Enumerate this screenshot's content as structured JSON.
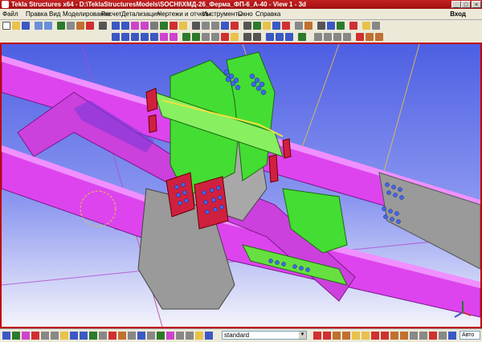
{
  "window": {
    "title": "Tekla Structures x64 - D:\\TeklaStructuresModels\\SOCHI\\ХМД-26_Ферма_ФП-6_А-40 - View 1 - 3d"
  },
  "menu": {
    "items": [
      "Файл",
      "Правка",
      "Вид",
      "Моделирование",
      "Расчет",
      "Детализация",
      "Чертежи и отчеты",
      "Инструменты",
      "Окно",
      "Справка"
    ],
    "login": "Вход"
  },
  "statusbar": {
    "selection_filter": "standard",
    "snap_mode": "Авто"
  },
  "colors": {
    "accent": "#c00000",
    "beam": "#dd44ee",
    "plate_green": "#44dd33",
    "plate_grey": "#9a9a9a",
    "bolts": "#4466ee"
  }
}
